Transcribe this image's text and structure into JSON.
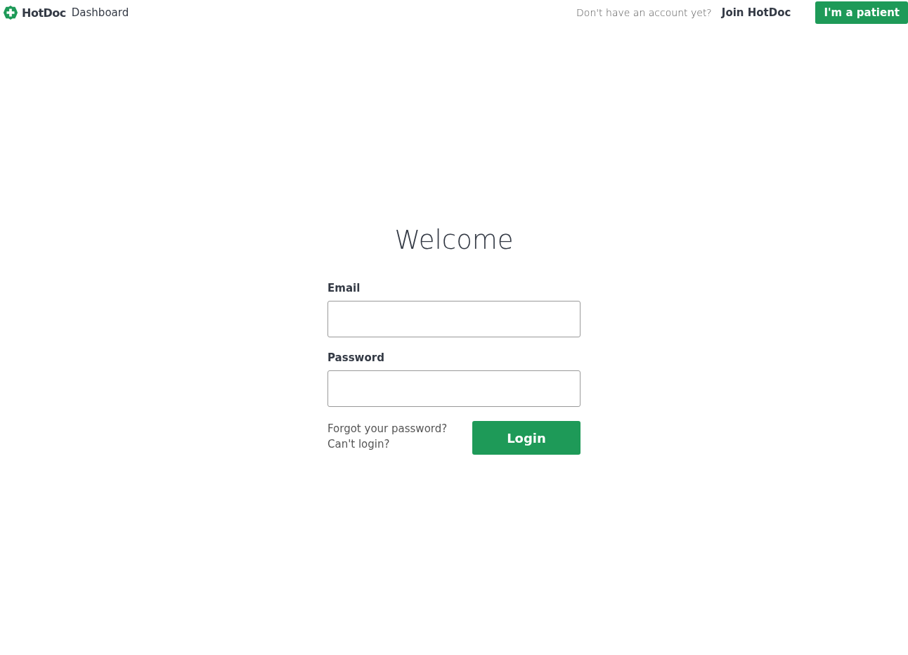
{
  "header": {
    "brand": "HotDoc",
    "product": "Dashboard",
    "prompt": "Don't have an account yet?",
    "join_link": "Join HotDoc",
    "patient_button": "I'm a patient"
  },
  "form": {
    "title": "Welcome",
    "fields": [
      {
        "label": "Email"
      },
      {
        "label": "Password"
      }
    ],
    "links": [
      "Forgot your password?",
      "Can't login?"
    ],
    "submit": "Login"
  }
}
